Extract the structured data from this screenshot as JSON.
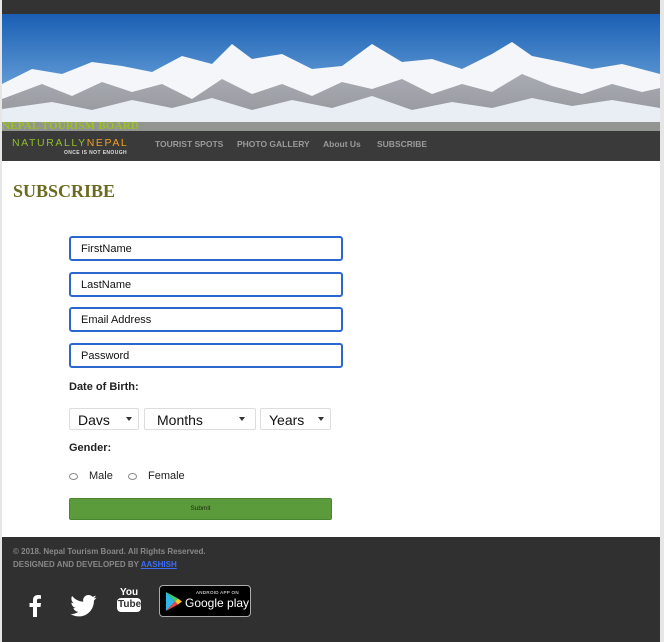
{
  "site": {
    "board_title": "NEPAL TOURISM BOARD",
    "logo_text_main": "NATURALLY",
    "logo_text_accent": "NEPAL",
    "logo_tagline": "ONCE IS NOT ENOUGH"
  },
  "nav": {
    "items": [
      {
        "label": "TOURIST SPOTS"
      },
      {
        "label": "PHOTO GALLERY"
      },
      {
        "label": "About Us"
      },
      {
        "label": "SUBSCRIBE"
      }
    ]
  },
  "page": {
    "title": "SUBSCRIBE"
  },
  "form": {
    "first_name_placeholder": "FirstName",
    "last_name_placeholder": "LastName",
    "email_placeholder": "Email Address",
    "password_placeholder": "Password",
    "dob_label": "Date of Birth:",
    "day_value": "Davs",
    "month_value": "Months",
    "year_value": "Years",
    "gender_label": "Gender:",
    "gender_options": [
      "Male",
      "Female"
    ],
    "submit_label": "Submit"
  },
  "footer": {
    "copyright": "© 2018. Nepal Tourism Board. All Rights Reserved.",
    "designed_by": "DESIGNED AND DEVELOPED BY",
    "designer": "AASHISH",
    "youtube_you": "You",
    "youtube_tube": "Tube",
    "gplay_small": "ANDROID APP ON",
    "gplay_big": "Google play"
  },
  "icons": [
    "facebook-icon",
    "twitter-icon",
    "youtube-icon",
    "google-play-icon"
  ],
  "colors": {
    "form_border": "#2c67d0",
    "submit_bg": "#5b9b3c",
    "title_color": "#6b6b1f",
    "board_title_color": "#9bc31c",
    "footer_bg": "#303030",
    "nav_bg": "#3a3a3a"
  }
}
